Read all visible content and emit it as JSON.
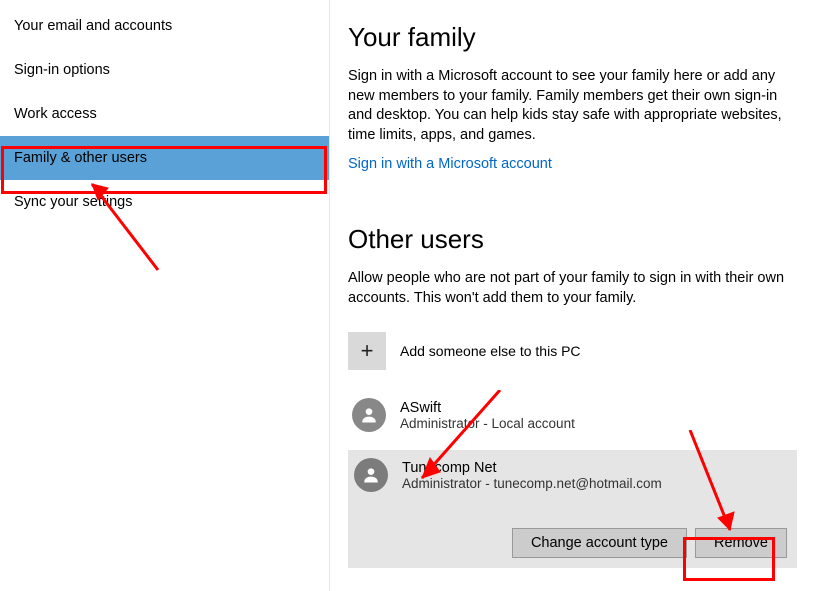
{
  "sidebar": {
    "items": [
      {
        "label": "Your email and accounts"
      },
      {
        "label": "Sign-in options"
      },
      {
        "label": "Work access"
      },
      {
        "label": "Family & other users"
      },
      {
        "label": "Sync your settings"
      }
    ]
  },
  "family": {
    "title": "Your family",
    "desc": "Sign in with a Microsoft account to see your family here or add any new members to your family. Family members get their own sign-in and desktop. You can help kids stay safe with appropriate websites, time limits, apps, and games.",
    "link": "Sign in with a Microsoft account"
  },
  "other": {
    "title": "Other users",
    "desc": "Allow people who are not part of your family to sign in with their own accounts. This won't add them to your family.",
    "add_label": "Add someone else to this PC",
    "users": [
      {
        "name": "ASwift",
        "sub": "Administrator - Local account"
      },
      {
        "name": "Tunecomp Net",
        "sub": "Administrator - tunecomp.net@hotmail.com"
      }
    ],
    "actions": {
      "change": "Change account type",
      "remove": "Remove"
    }
  }
}
